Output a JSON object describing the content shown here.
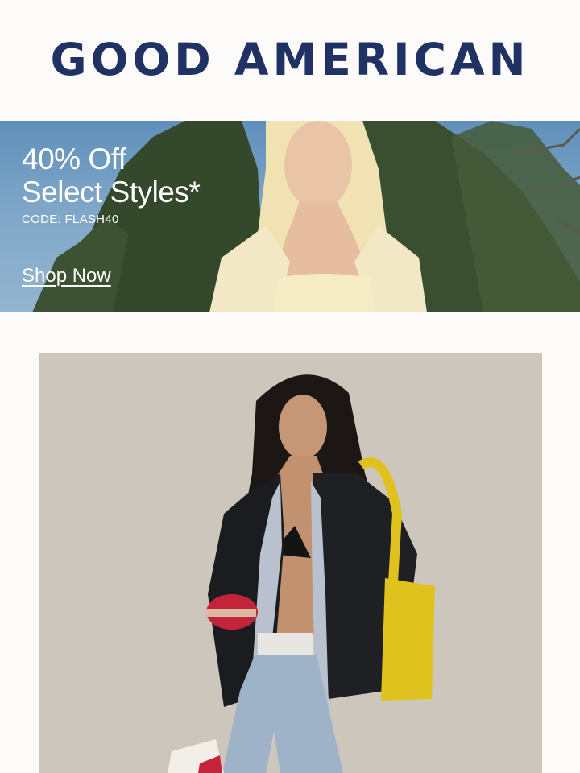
{
  "brand": {
    "name": "GOOD AMERICAN",
    "color": "#1f3263"
  },
  "hero": {
    "title_line1": "40% Off",
    "title_line2": "Select Styles*",
    "code": "CODE: FLASH40",
    "cta": "Shop Now"
  },
  "colors": {
    "background": "#fcfbf9",
    "promo_text": "#ffffff",
    "photo_backdrop": "#cdc6bd"
  }
}
